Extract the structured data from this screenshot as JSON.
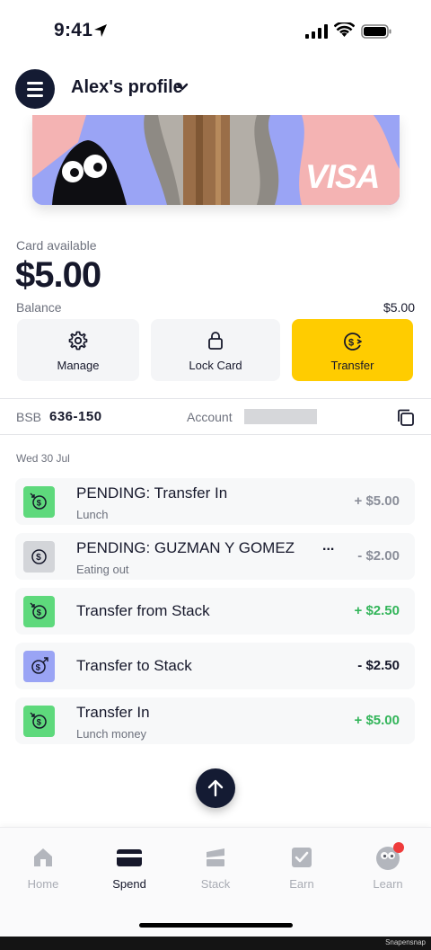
{
  "status_bar": {
    "time": "9:41"
  },
  "header": {
    "profile_title": "Alex's profile"
  },
  "card": {
    "brand": "VISA"
  },
  "balance": {
    "card_available_label": "Card available",
    "amount": "$5.00",
    "balance_label": "Balance",
    "balance_value": "$5.00"
  },
  "actions": [
    {
      "label": "Manage",
      "icon": "gear-icon"
    },
    {
      "label": "Lock Card",
      "icon": "lock-icon"
    },
    {
      "label": "Transfer",
      "icon": "transfer-icon"
    }
  ],
  "account": {
    "bsb_label": "BSB",
    "bsb_value": "636-150",
    "account_label": "Account"
  },
  "transactions": {
    "date": "Wed 30 Jul",
    "items": [
      {
        "title": "PENDING: Transfer In",
        "subtitle": "Lunch",
        "amount": "+ $5.00",
        "icon": "dollar-in-icon",
        "status": "pending"
      },
      {
        "title": "PENDING: GUZMAN Y GOMEZ",
        "subtitle": "Eating out",
        "amount": "- $2.00",
        "icon": "dollar-icon",
        "status": "pending",
        "more": "..."
      },
      {
        "title": "Transfer from Stack",
        "subtitle": "",
        "amount": "+ $2.50",
        "icon": "dollar-in-icon",
        "status": "credit"
      },
      {
        "title": "Transfer to Stack",
        "subtitle": "",
        "amount": "- $2.50",
        "icon": "dollar-out-icon",
        "status": "debit"
      },
      {
        "title": "Transfer In",
        "subtitle": "Lunch money",
        "amount": "+ $5.00",
        "icon": "dollar-in-icon",
        "status": "credit"
      }
    ]
  },
  "tabs": [
    {
      "label": "Home",
      "icon": "home-icon",
      "active": false
    },
    {
      "label": "Spend",
      "icon": "card-icon",
      "active": true
    },
    {
      "label": "Stack",
      "icon": "stack-icon",
      "active": false
    },
    {
      "label": "Earn",
      "icon": "checkbox-icon",
      "active": false
    },
    {
      "label": "Learn",
      "icon": "learn-icon",
      "active": false
    }
  ],
  "watermark": "Snapensnap",
  "colors": {
    "navy": "#141b33",
    "accent_yellow": "#ffcc00",
    "positive_green": "#33b55a",
    "icon_green": "#5ed97c",
    "card_lilac": "#9aa4f5",
    "card_pink": "#f4b3b3",
    "notification_red": "#ef3b3b"
  }
}
